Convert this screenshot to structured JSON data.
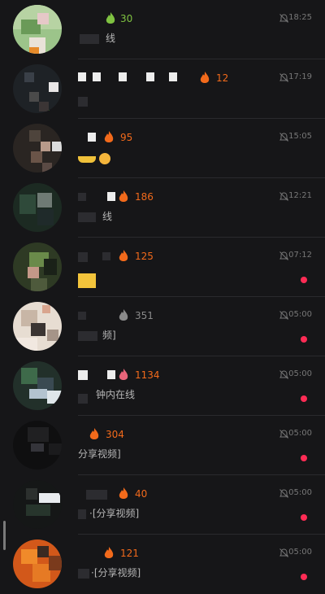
{
  "conversations": [
    {
      "streak": "30",
      "flame": "green",
      "time": "18:25",
      "preview": "线",
      "muted": true,
      "unread": false
    },
    {
      "streak": "12",
      "flame": "orange",
      "time": "17:19",
      "preview": "",
      "muted": true,
      "unread": false
    },
    {
      "streak": "95",
      "flame": "orange",
      "time": "15:05",
      "preview": "",
      "muted": true,
      "unread": false
    },
    {
      "streak": "186",
      "flame": "orange",
      "time": "12:21",
      "preview": "线",
      "muted": true,
      "unread": false
    },
    {
      "streak": "125",
      "flame": "orange",
      "time": "07:12",
      "preview": "",
      "muted": true,
      "unread": true
    },
    {
      "streak": "351",
      "flame": "gray",
      "time": "05:00",
      "preview": "频]",
      "muted": true,
      "unread": true
    },
    {
      "streak": "1134",
      "flame": "pink",
      "time": "05:00",
      "preview": "钟内在线",
      "muted": true,
      "unread": true
    },
    {
      "streak": "304",
      "flame": "orange",
      "time": "05:00",
      "preview": "分享视频]",
      "muted": true,
      "unread": true
    },
    {
      "streak": "40",
      "flame": "orange",
      "time": "05:00",
      "preview": "·[分享视频]",
      "muted": true,
      "unread": true
    },
    {
      "streak": "121",
      "flame": "orange",
      "time": "05:00",
      "preview": "·[分享视频]",
      "muted": true,
      "unread": true
    }
  ],
  "colors": {
    "background": "#161618",
    "streak_orange": "#f26a1b",
    "streak_green": "#7fc241",
    "streak_gray": "#8a8a8a",
    "unread_dot": "#ff2c55",
    "time": "#777777"
  },
  "icons": {
    "streak": "flame-icon",
    "muted": "bell-slash-icon",
    "unread": "unread-dot"
  }
}
